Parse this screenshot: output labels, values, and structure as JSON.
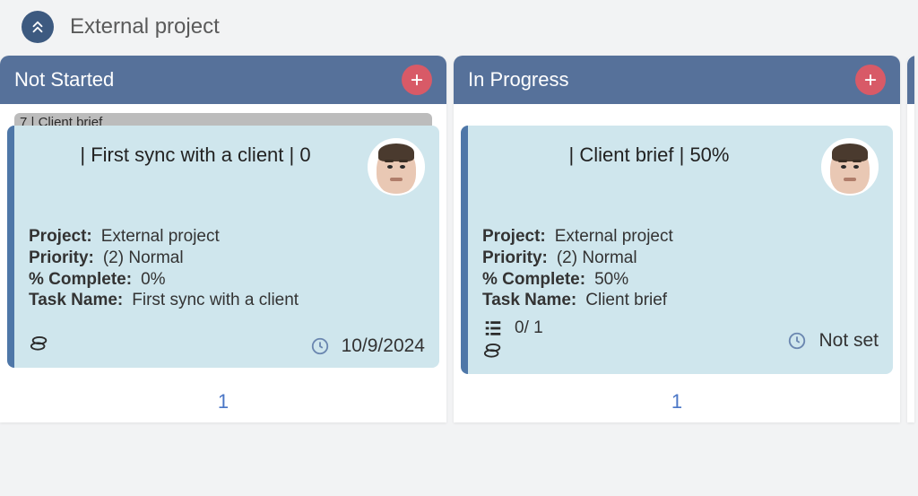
{
  "board": {
    "title": "External project"
  },
  "columns": [
    {
      "title": "Not Started",
      "count": "1",
      "card": {
        "predecessor": "7 | Client brief",
        "title_line": "| First sync with a client | 0",
        "project_label": "Project:",
        "project_value": "External project",
        "priority_label": "Priority:",
        "priority_value": "(2) Normal",
        "complete_label": "% Complete:",
        "complete_value": "0%",
        "taskname_label": "Task Name:",
        "taskname_value": "First sync with a client",
        "subtasks_text": "",
        "due_text": "10/9/2024"
      }
    },
    {
      "title": "In Progress",
      "count": "1",
      "card": {
        "predecessor": "",
        "title_line": "| Client brief | 50%",
        "project_label": "Project:",
        "project_value": "External project",
        "priority_label": "Priority:",
        "priority_value": "(2) Normal",
        "complete_label": "% Complete:",
        "complete_value": "50%",
        "taskname_label": "Task Name:",
        "taskname_value": "Client brief",
        "subtasks_text": "0/ 1",
        "due_text": "Not set"
      }
    }
  ]
}
